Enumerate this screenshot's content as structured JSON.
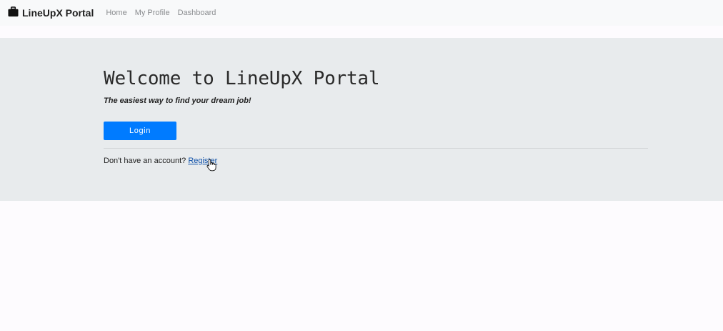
{
  "navbar": {
    "brand_icon": "briefcase-icon",
    "brand": "LineUpX Portal",
    "links": [
      {
        "label": "Home"
      },
      {
        "label": "My Profile"
      },
      {
        "label": "Dashboard"
      }
    ]
  },
  "hero": {
    "title": "Welcome to LineUpX Portal",
    "tagline": "The easiest way to find your dream job!",
    "login_label": "Login",
    "register_prompt": "Don't have an account?",
    "register_label": "Register"
  },
  "colors": {
    "primary": "#007bff",
    "navbar_bg": "#f8f9fa",
    "hero_bg": "#e8ebed",
    "link": "#0c4fa8"
  },
  "cursor": "hand-pointer-icon"
}
